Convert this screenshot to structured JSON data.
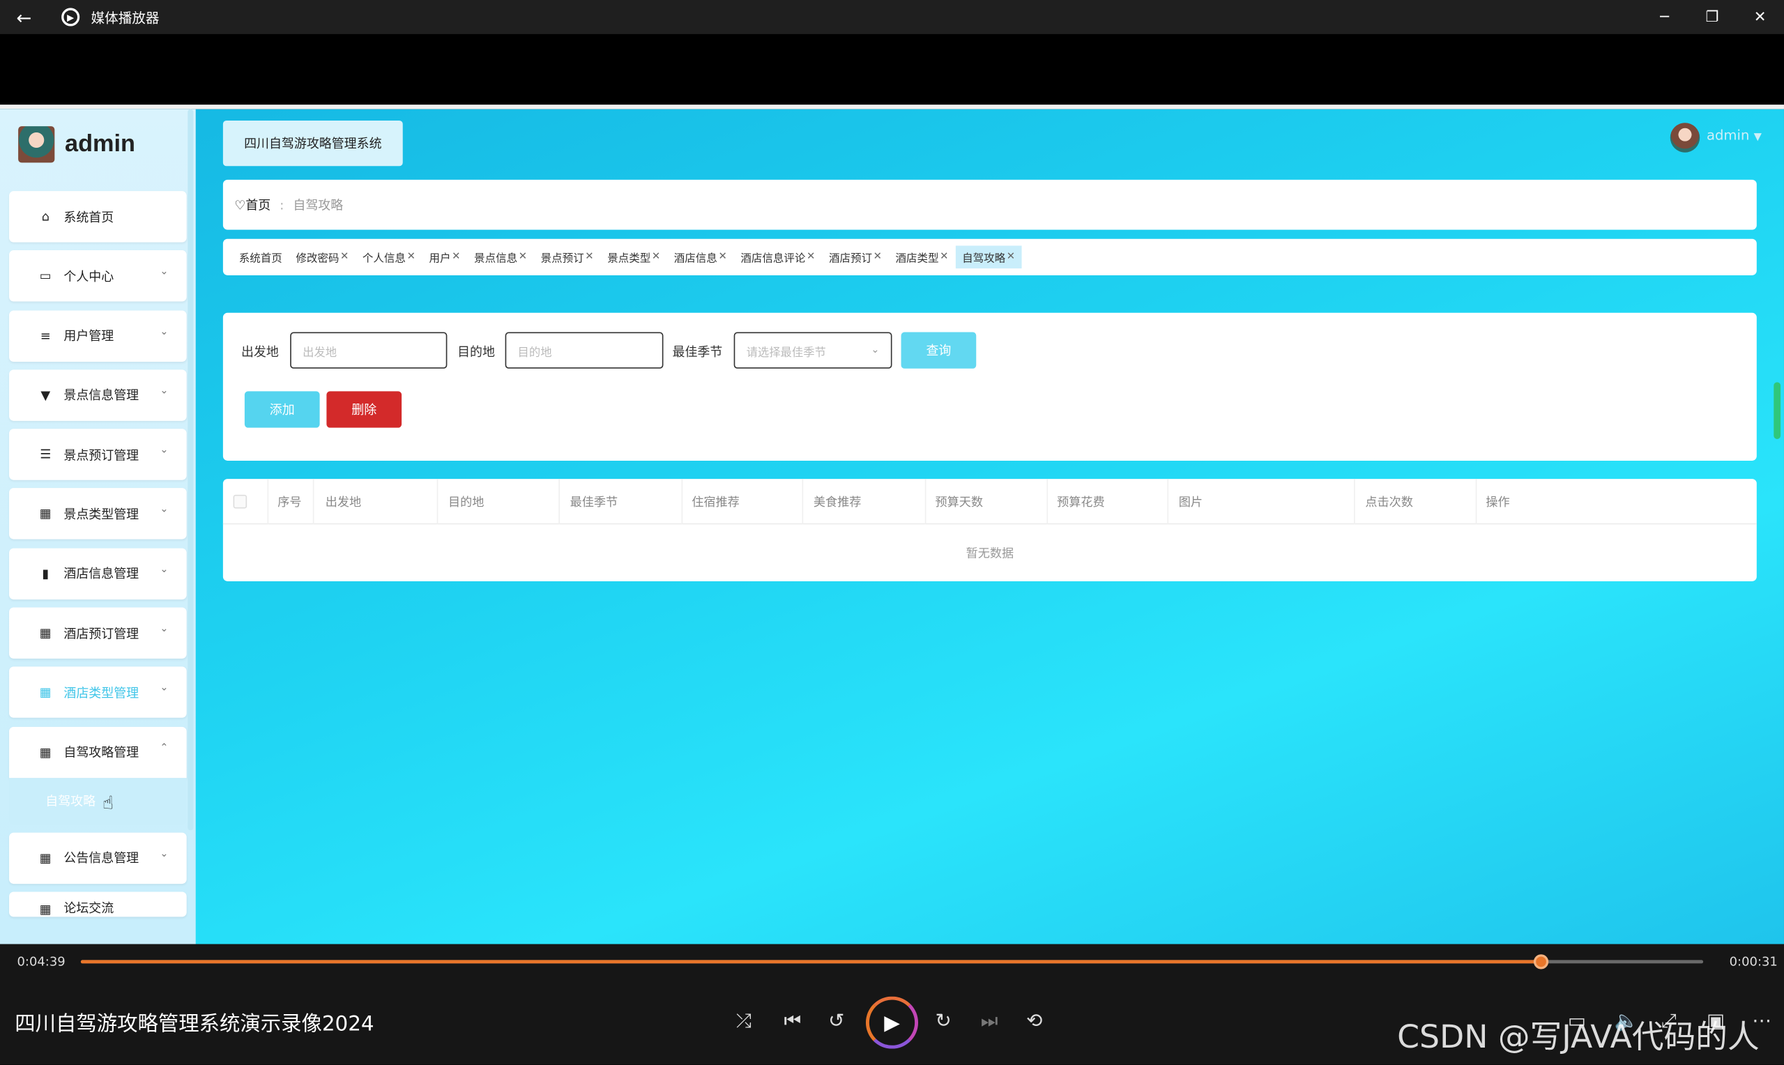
{
  "window": {
    "title": "媒体播放器",
    "icons": {
      "back": "arrow-left-icon",
      "minimize": "minimize-icon",
      "maximize": "restore-icon",
      "close": "close-icon"
    }
  },
  "sidebar": {
    "username": "admin",
    "items": [
      {
        "label": "系统首页",
        "icon": "home-icon",
        "glyph": "⌂"
      },
      {
        "label": "个人中心",
        "icon": "card-icon",
        "glyph": "▭"
      },
      {
        "label": "用户管理",
        "icon": "sliders-icon",
        "glyph": "≡"
      },
      {
        "label": "景点信息管理",
        "icon": "sign-icon",
        "glyph": "▾"
      },
      {
        "label": "景点预订管理",
        "icon": "list-icon",
        "glyph": "☰"
      },
      {
        "label": "景点类型管理",
        "icon": "grid-icon",
        "glyph": "▦"
      },
      {
        "label": "酒店信息管理",
        "icon": "library-icon",
        "glyph": "▮"
      },
      {
        "label": "酒店预订管理",
        "icon": "grid-icon",
        "glyph": "▦"
      },
      {
        "label": "酒店类型管理",
        "icon": "grid-icon",
        "glyph": "▦"
      },
      {
        "label": "自驾攻略管理",
        "icon": "grid-icon",
        "glyph": "▦"
      },
      {
        "label": "公告信息管理",
        "icon": "grid-icon",
        "glyph": "▦"
      },
      {
        "label": "论坛交流",
        "icon": "forum-icon",
        "glyph": "▦"
      }
    ],
    "submenu_item": "自驾攻略"
  },
  "header": {
    "system_name": "四川自驾游攻略管理系统",
    "user": "admin"
  },
  "breadcrumb": {
    "home": "首页",
    "current": "自驾攻略"
  },
  "tabs": [
    {
      "label": "系统首页"
    },
    {
      "label": "修改密码"
    },
    {
      "label": "个人信息"
    },
    {
      "label": "用户"
    },
    {
      "label": "景点信息"
    },
    {
      "label": "景点预订"
    },
    {
      "label": "景点类型"
    },
    {
      "label": "酒店信息"
    },
    {
      "label": "酒店信息评论"
    },
    {
      "label": "酒店预订"
    },
    {
      "label": "酒店类型"
    },
    {
      "label": "自驾攻略"
    }
  ],
  "search": {
    "departure_label": "出发地",
    "departure_placeholder": "出发地",
    "destination_label": "目的地",
    "destination_placeholder": "目的地",
    "season_label": "最佳季节",
    "season_placeholder": "请选择最佳季节",
    "query_button": "查询",
    "add_button": "添加",
    "delete_button": "删除"
  },
  "table": {
    "columns": [
      "序号",
      "出发地",
      "目的地",
      "最佳季节",
      "住宿推荐",
      "美食推荐",
      "预算天数",
      "预算花费",
      "图片",
      "点击次数",
      "操作"
    ],
    "empty_text": "暂无数据"
  },
  "player": {
    "elapsed": "0:04:39",
    "remaining": "0:00:31",
    "progress_fraction": 0.9,
    "video_title": "四川自驾游攻略管理系统演示录像2024",
    "watermark": "CSDN @写JAVA代码的人",
    "accent_color": "#e8762a"
  },
  "colors": {
    "accent": "#3fc5e8",
    "danger": "#d32a2a",
    "add_button": "#55d4ef"
  }
}
